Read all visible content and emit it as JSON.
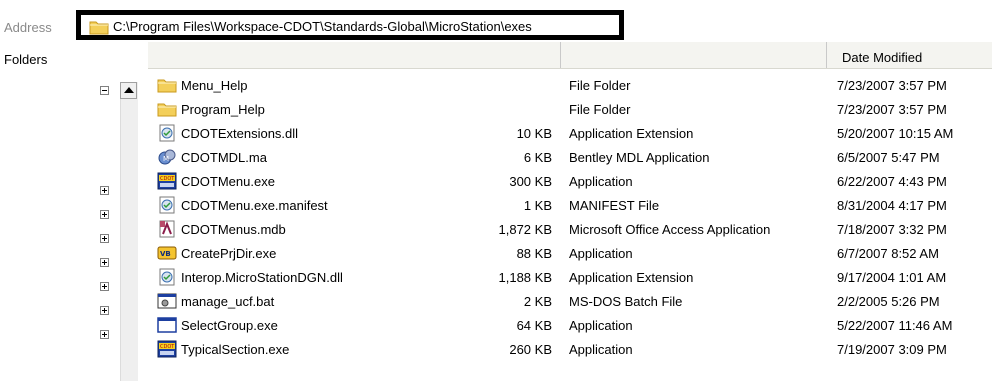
{
  "address": {
    "label": "Address",
    "path": "C:\\Program Files\\Workspace-CDOT\\Standards-Global\\MicroStation\\exes"
  },
  "folders_label": "Folders",
  "columns": {
    "date": "Date Modified"
  },
  "files": [
    {
      "name": "Menu_Help",
      "size": "",
      "type": "File Folder",
      "date": "7/23/2007 3:57 PM",
      "icon": "folder-icon"
    },
    {
      "name": "Program_Help",
      "size": "",
      "type": "File Folder",
      "date": "7/23/2007 3:57 PM",
      "icon": "folder-icon"
    },
    {
      "name": "CDOTExtensions.dll",
      "size": "10 KB",
      "type": "Application Extension",
      "date": "5/20/2007 10:15 AM",
      "icon": "dll-icon"
    },
    {
      "name": "CDOTMDL.ma",
      "size": "6 KB",
      "type": "Bentley MDL Application",
      "date": "6/5/2007 5:47 PM",
      "icon": "mdl-icon"
    },
    {
      "name": "CDOTMenu.exe",
      "size": "300 KB",
      "type": "Application",
      "date": "6/22/2007 4:43 PM",
      "icon": "cdot-exe-icon"
    },
    {
      "name": "CDOTMenu.exe.manifest",
      "size": "1 KB",
      "type": "MANIFEST File",
      "date": "8/31/2004 4:17 PM",
      "icon": "manifest-icon"
    },
    {
      "name": "CDOTMenus.mdb",
      "size": "1,872 KB",
      "type": "Microsoft Office Access Application",
      "date": "7/18/2007 3:32 PM",
      "icon": "access-icon"
    },
    {
      "name": "CreatePrjDir.exe",
      "size": "88 KB",
      "type": "Application",
      "date": "6/7/2007 8:52 AM",
      "icon": "vb-exe-icon"
    },
    {
      "name": "Interop.MicroStationDGN.dll",
      "size": "1,188 KB",
      "type": "Application Extension",
      "date": "9/17/2004 1:01 AM",
      "icon": "dll-icon"
    },
    {
      "name": "manage_ucf.bat",
      "size": "2 KB",
      "type": "MS-DOS Batch File",
      "date": "2/2/2005 5:26 PM",
      "icon": "batch-icon"
    },
    {
      "name": "SelectGroup.exe",
      "size": "64 KB",
      "type": "Application",
      "date": "5/22/2007 11:46 AM",
      "icon": "window-exe-icon"
    },
    {
      "name": "TypicalSection.exe",
      "size": "260 KB",
      "type": "Application",
      "date": "7/19/2007 3:09 PM",
      "icon": "cdot-exe-icon"
    }
  ],
  "colors": {
    "folder": "#f3cf5a",
    "folder_dark": "#c89a1e",
    "border": "#000000"
  }
}
